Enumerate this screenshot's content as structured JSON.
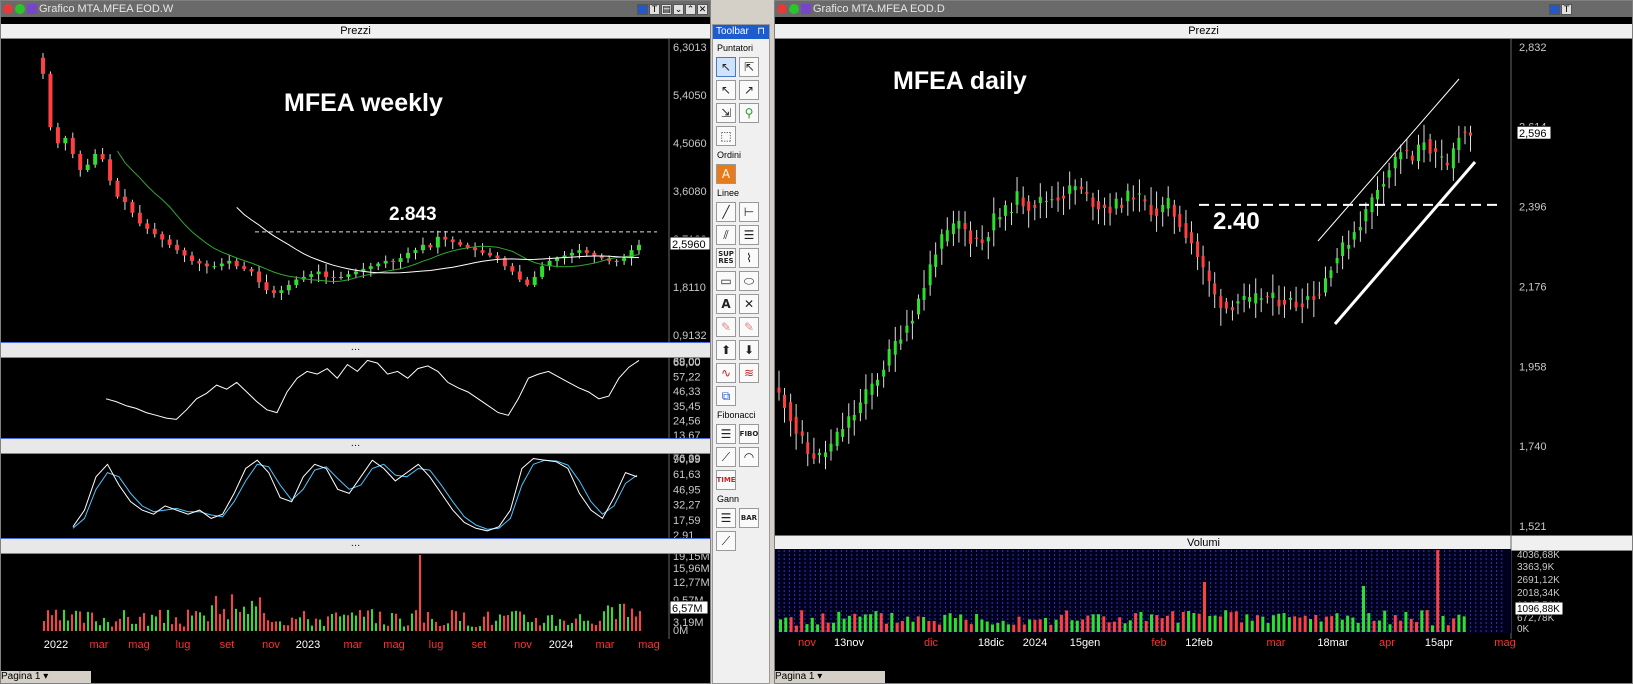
{
  "left_window": {
    "title": "Grafico MTA.MFEA EOD.W",
    "price_pane_title": "Prezzi",
    "annotation_title": "MFEA weekly",
    "annotation_level": "2.843",
    "current_price": "2,5960",
    "price_ticks": [
      "6,3013",
      "5,4050",
      "4,5060",
      "3,6080",
      "2,7100",
      "1,8110",
      "0,9132"
    ],
    "rsi_ticks": [
      "68,00",
      "57,22",
      "46,33",
      "35,45",
      "24,56",
      "13,67"
    ],
    "rsi_overlap_top": "69,00",
    "stoch_ticks": [
      "90,99",
      "61,63",
      "46,95",
      "32,27",
      "17,59",
      "2,91"
    ],
    "stoch_overlap_top": "76,39",
    "volume_ticks": [
      "19,15M",
      "15,96M",
      "12,77M",
      "9,57M",
      "3,19M",
      "0M"
    ],
    "volume_current": "6,57M",
    "x_labels": [
      {
        "t": "2022",
        "c": "#ffffff"
      },
      {
        "t": "mar",
        "c": "#ff3030"
      },
      {
        "t": "mag",
        "c": "#ff3030"
      },
      {
        "t": "lug",
        "c": "#ff3030"
      },
      {
        "t": "set",
        "c": "#ff3030"
      },
      {
        "t": "nov",
        "c": "#ff3030"
      },
      {
        "t": "2023",
        "c": "#ffffff"
      },
      {
        "t": "mar",
        "c": "#ff3030"
      },
      {
        "t": "mag",
        "c": "#ff3030"
      },
      {
        "t": "lug",
        "c": "#ff3030"
      },
      {
        "t": "set",
        "c": "#ff3030"
      },
      {
        "t": "nov",
        "c": "#ff3030"
      },
      {
        "t": "2024",
        "c": "#ffffff"
      },
      {
        "t": "mar",
        "c": "#ff3030"
      },
      {
        "t": "mag",
        "c": "#ff3030"
      }
    ],
    "page_tab": "Pagina 1"
  },
  "right_window": {
    "title": "Grafico MTA.MFEA EOD.D",
    "price_pane_title": "Prezzi",
    "volume_pane_title": "Volumi",
    "annotation_title": "MFEA daily",
    "annotation_level": "2.40",
    "current_price": "2,596",
    "price_ticks": [
      "2,832",
      "2,614",
      "2,396",
      "2,176",
      "1,958",
      "1,740",
      "1,521"
    ],
    "volume_ticks": [
      "4036,68K",
      "3363,9K",
      "2691,12K",
      "2018,34K",
      "1345,56K",
      "672,78K",
      "0K"
    ],
    "volume_current": "1096,88K",
    "x_labels": [
      {
        "t": "nov",
        "c": "#ff3030"
      },
      {
        "t": "13nov",
        "c": "#ffffff"
      },
      {
        "t": "dic",
        "c": "#ff3030"
      },
      {
        "t": "18dic",
        "c": "#ffffff"
      },
      {
        "t": "2024",
        "c": "#ffffff"
      },
      {
        "t": "15gen",
        "c": "#ffffff"
      },
      {
        "t": "feb",
        "c": "#ff3030"
      },
      {
        "t": "12feb",
        "c": "#ffffff"
      },
      {
        "t": "mar",
        "c": "#ff3030"
      },
      {
        "t": "18mar",
        "c": "#ffffff"
      },
      {
        "t": "apr",
        "c": "#ff3030"
      },
      {
        "t": "15apr",
        "c": "#ffffff"
      },
      {
        "t": "mag",
        "c": "#ff3030"
      }
    ],
    "page_tab": "Pagina 1"
  },
  "toolbar": {
    "title": "Toolbar",
    "sections": [
      "Puntatori",
      "Ordini",
      "Linee",
      "Fibonacci",
      "Gann"
    ]
  },
  "chart_data": [
    {
      "type": "candlestick",
      "title": "MFEA weekly",
      "ylim": [
        0.9132,
        6.3013
      ],
      "horizontal_line": 2.843,
      "series_weekly_close": [
        5.8,
        4.8,
        4.5,
        4.6,
        4.3,
        4.0,
        4.1,
        4.3,
        4.2,
        3.8,
        3.5,
        3.4,
        3.2,
        3.0,
        2.9,
        2.8,
        2.7,
        2.6,
        2.5,
        2.4,
        2.3,
        2.25,
        2.2,
        2.2,
        2.25,
        2.3,
        2.2,
        2.15,
        2.1,
        1.9,
        1.75,
        1.7,
        1.75,
        1.85,
        1.95,
        2.0,
        2.05,
        2.1,
        2.0,
        1.98,
        2.0,
        2.05,
        2.1,
        2.15,
        2.2,
        2.25,
        2.3,
        2.28,
        2.35,
        2.45,
        2.5,
        2.6,
        2.55,
        2.75,
        2.7,
        2.65,
        2.6,
        2.55,
        2.5,
        2.45,
        2.4,
        2.35,
        2.2,
        2.1,
        1.95,
        1.85,
        2.0,
        2.2,
        2.3,
        2.35,
        2.4,
        2.45,
        2.5,
        2.45,
        2.4,
        2.35,
        2.3,
        2.3,
        2.35,
        2.5,
        2.6
      ],
      "rsi": [
        40,
        38,
        35,
        33,
        30,
        28,
        26,
        25,
        32,
        40,
        44,
        50,
        47,
        52,
        45,
        38,
        32,
        30,
        45,
        55,
        60,
        58,
        62,
        55,
        65,
        60,
        68,
        66,
        58,
        60,
        55,
        62,
        64,
        60,
        52,
        48,
        45,
        40,
        35,
        30,
        28,
        40,
        55,
        58,
        60,
        56,
        52,
        48,
        45,
        40,
        42,
        55,
        63,
        68
      ],
      "stochastic_k": [
        10,
        30,
        70,
        85,
        60,
        40,
        30,
        25,
        35,
        30,
        25,
        30,
        20,
        25,
        50,
        80,
        90,
        75,
        45,
        40,
        70,
        85,
        80,
        55,
        50,
        70,
        90,
        80,
        65,
        75,
        85,
        70,
        50,
        30,
        15,
        8,
        5,
        10,
        30,
        80,
        92,
        90,
        88,
        80,
        50,
        30,
        20,
        45,
        75,
        70
      ],
      "stochastic_d": [
        8,
        20,
        55,
        75,
        70,
        50,
        35,
        28,
        30,
        32,
        28,
        28,
        24,
        22,
        40,
        65,
        85,
        82,
        60,
        42,
        55,
        78,
        82,
        68,
        55,
        60,
        80,
        85,
        72,
        70,
        80,
        78,
        60,
        40,
        22,
        12,
        7,
        8,
        20,
        60,
        85,
        90,
        89,
        84,
        65,
        40,
        25,
        35,
        62,
        72
      ]
    },
    {
      "type": "candlestick",
      "title": "MFEA daily",
      "ylim": [
        1.521,
        2.832
      ],
      "horizontal_line": 2.4,
      "series_daily_close": [
        1.86,
        1.78,
        1.72,
        1.71,
        1.74,
        1.79,
        1.83,
        1.88,
        1.93,
        1.99,
        2.05,
        2.1,
        2.18,
        2.28,
        2.32,
        2.35,
        2.31,
        2.3,
        2.36,
        2.38,
        2.42,
        2.4,
        2.41,
        2.42,
        2.43,
        2.45,
        2.42,
        2.4,
        2.39,
        2.41,
        2.43,
        2.4,
        2.38,
        2.4,
        2.35,
        2.3,
        2.22,
        2.15,
        2.12,
        2.14,
        2.13,
        2.15,
        2.14,
        2.14,
        2.13,
        2.15,
        2.16,
        2.24,
        2.28,
        2.33,
        2.38,
        2.45,
        2.5,
        2.55,
        2.52,
        2.58,
        2.53,
        2.5,
        2.6,
        2.596
      ]
    }
  ]
}
